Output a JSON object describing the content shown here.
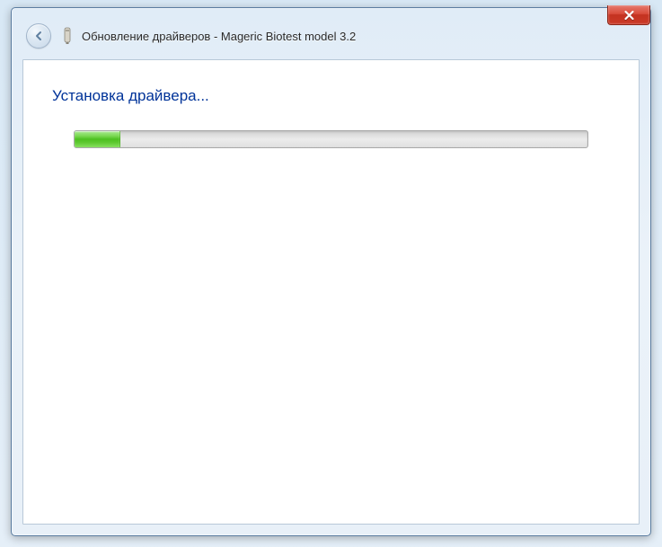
{
  "window": {
    "title": "Обновление драйверов - Mageric Biotest model 3.2"
  },
  "content": {
    "heading": "Установка драйвера...",
    "progress_percent": 9
  }
}
